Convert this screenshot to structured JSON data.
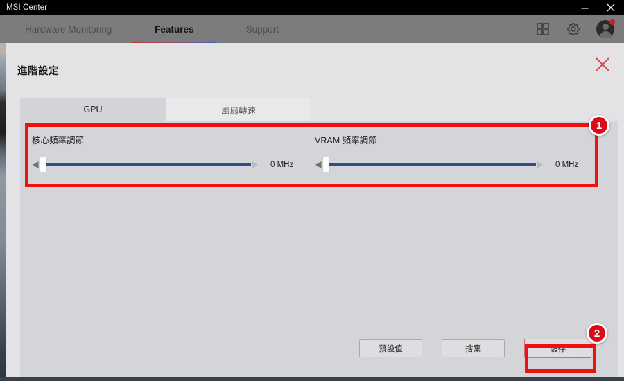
{
  "window": {
    "title": "MSI Center",
    "controls": [
      {
        "name": "minimize",
        "glyph": "minimize-icon"
      },
      {
        "name": "close",
        "glyph": "close-icon"
      }
    ]
  },
  "navbar": {
    "tabs": [
      {
        "label": "Hardware Monitoring",
        "active": false
      },
      {
        "label": "Features",
        "active": true
      },
      {
        "label": "Support",
        "active": false
      }
    ],
    "icons": [
      {
        "name": "apps-grid-icon"
      },
      {
        "name": "gear-icon"
      },
      {
        "name": "user-avatar"
      }
    ],
    "active_underline_colors": [
      "#c0392b",
      "#3d5fc4"
    ],
    "notification_dot_color": "#d11a1a"
  },
  "dialog": {
    "title": "進階設定",
    "close_label": "×",
    "close_color": "#d94a4a",
    "tabs": [
      {
        "label": "GPU",
        "active": true
      },
      {
        "label": "風扇轉速",
        "active": false
      }
    ],
    "sliders": [
      {
        "label": "核心頻率調節",
        "value": "0 MHz",
        "position_percent": 0,
        "track_color": "#2e4f85"
      },
      {
        "label": "VRAM 頻率調節",
        "value": "0 MHz",
        "position_percent": 0,
        "track_color": "#2e4f85"
      }
    ],
    "buttons": [
      {
        "label": "預設值",
        "style": "plain"
      },
      {
        "label": "捨棄",
        "style": "plain"
      },
      {
        "label": "儲存",
        "style": "gradient"
      }
    ]
  },
  "annotations": {
    "highlight_color": "#ee1111",
    "badges": [
      {
        "number": "1",
        "target": "slider-section"
      },
      {
        "number": "2",
        "target": "save-button"
      }
    ]
  }
}
